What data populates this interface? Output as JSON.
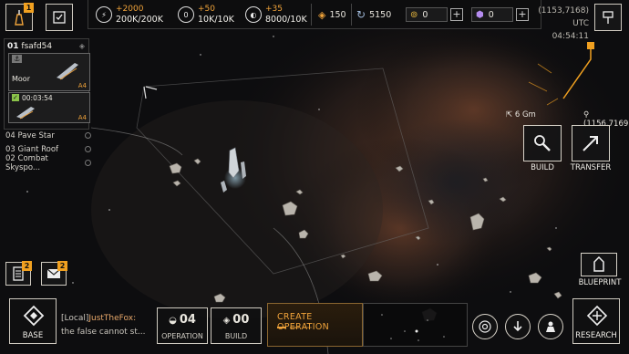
{
  "resources": [
    {
      "icon": "power-icon",
      "delta": "+2000",
      "value": "200K/200K"
    },
    {
      "icon": "zero-g-icon",
      "delta": "+50",
      "value": "10K/10K"
    },
    {
      "icon": "crystal-icon",
      "delta": "+35",
      "value": "8000/10K"
    }
  ],
  "currencies": {
    "fuel": "150",
    "credits": "5150",
    "gold": "0",
    "premium": "0"
  },
  "location": {
    "coords": "(1153,7168)",
    "time": "UTC 04:54:11"
  },
  "fleet": {
    "number": "01",
    "name": "fsafd54",
    "card1": {
      "label": "Moor",
      "level": "A4"
    },
    "card2": {
      "timer": "00:03:54",
      "level": "A4"
    }
  },
  "queue": [
    {
      "num": "04",
      "name": "Pave Star"
    },
    {
      "num": "03",
      "name": "Giant Roof"
    },
    {
      "num": "02",
      "name": "Combat Skyspo..."
    }
  ],
  "map": {
    "distance": "6 Gm",
    "target_coords": "(1156,7169)"
  },
  "actions": {
    "build": "BUILD",
    "transfer": "TRANSFER",
    "blueprint": "BLUEPRINT",
    "research": "RESEARCH"
  },
  "badges": {
    "top_tool": "1",
    "reports": "2",
    "mail": "2"
  },
  "bottom": {
    "base": "BASE",
    "chat_channel": "[Local]",
    "chat_user": "JustTheFox:",
    "chat_message": "the false cannot st...",
    "operation_count": "04",
    "operation_label": "OPERATION",
    "build_count": "00",
    "build_label": "BUILD",
    "create_operation": "CREATE OPERATION"
  },
  "colors": {
    "accent": "#f0a33a",
    "panel": "#121213",
    "border": "#cfcac0"
  }
}
